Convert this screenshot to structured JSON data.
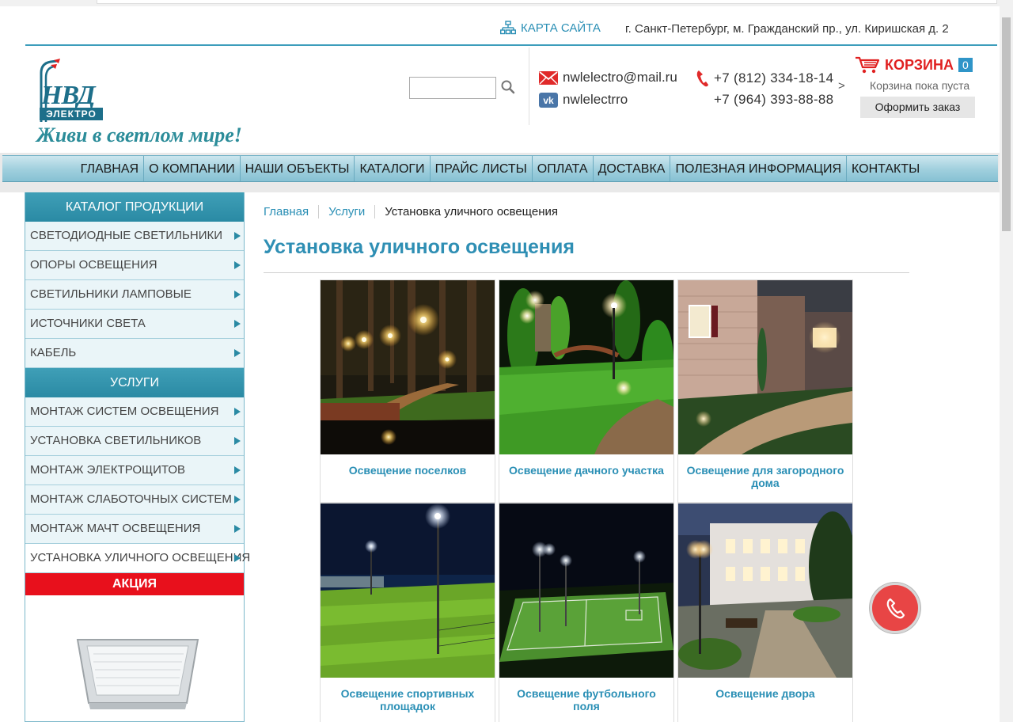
{
  "header": {
    "sitemap_label": "КАРТА САЙТА",
    "address": "г. Санкт-Петербург, м. Гражданский пр., ул. Киришская д. 2",
    "logo_text": "НВД",
    "logo_sub": "ЭЛЕКТРО",
    "slogan": "Живи в светлом мире!",
    "search_placeholder": "",
    "email": "nwlelectro@mail.ru",
    "vk": "nwlelectrro",
    "phones": [
      "+7 (812) 334-18-14",
      "+7 (964) 393-88-88"
    ],
    "more_arrow": ">",
    "cart": {
      "title": "КОРЗИНА",
      "count": "0",
      "empty_text": "Корзина пока пуста",
      "order_button": "Оформить заказ"
    },
    "icons": {
      "sitemap": "sitemap-icon",
      "search": "search-icon",
      "mail": "mail-icon",
      "vk": "vk-icon",
      "phone": "phone-icon",
      "cart": "cart-icon"
    }
  },
  "nav": {
    "items": [
      "ГЛАВНАЯ",
      "О КОМПАНИИ",
      "НАШИ ОБЪЕКТЫ",
      "КАТАЛОГИ",
      "ПРАЙС ЛИСТЫ",
      "ОПЛАТА",
      "ДОСТАВКА",
      "ПОЛЕЗНАЯ ИНФОРМАЦИЯ",
      "КОНТАКТЫ"
    ]
  },
  "sidebar": {
    "catalog_title": "КАТАЛОГ ПРОДУКЦИИ",
    "catalog_items": [
      "СВЕТОДИОДНЫЕ СВЕТИЛЬНИКИ",
      "ОПОРЫ ОСВЕЩЕНИЯ",
      "СВЕТИЛЬНИКИ ЛАМПОВЫЕ",
      "ИСТОЧНИКИ СВЕТА",
      "КАБЕЛЬ"
    ],
    "services_title": "УСЛУГИ",
    "services_items": [
      "МОНТАЖ СИСТЕМ ОСВЕЩЕНИЯ",
      "УСТАНОВКА СВЕТИЛЬНИКОВ",
      "МОНТАЖ ЭЛЕКТРОЩИТОВ",
      "МОНТАЖ СЛАБОТОЧНЫХ СИСТЕМ",
      "МОНТАЖ МАЧТ ОСВЕЩЕНИЯ",
      "УСТАНОВКА УЛИЧНОГО ОСВЕЩЕНИЯ"
    ],
    "promo_title": "АКЦИЯ"
  },
  "breadcrumb": [
    "Главная",
    "Услуги",
    "Установка уличного освещения"
  ],
  "page_title": "Установка уличного освещения",
  "cards": [
    {
      "caption": "Освещение поселков"
    },
    {
      "caption": "Освещение дачного участка"
    },
    {
      "caption": "Освещение для загородного дома"
    },
    {
      "caption": "Освещение спортивных площадок"
    },
    {
      "caption": "Освещение футбольного поля"
    },
    {
      "caption": "Освещение двора"
    }
  ],
  "colors": {
    "accent": "#2f8fb4",
    "cart_red": "#e02020",
    "promo_red": "#e8101c",
    "call_button": "#e84545"
  }
}
